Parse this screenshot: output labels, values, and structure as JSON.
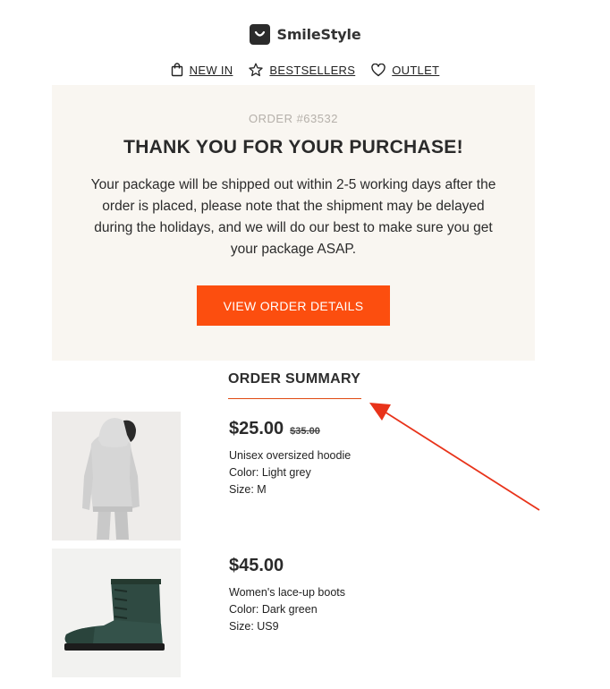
{
  "brand": {
    "name": "SmileStyle",
    "logo_icon": "smile-bag-icon"
  },
  "nav": [
    {
      "label": "NEW IN",
      "icon": "shopping-bag-icon"
    },
    {
      "label": "BESTSELLERS",
      "icon": "star-icon"
    },
    {
      "label": "OUTLET",
      "icon": "heart-icon"
    }
  ],
  "hero": {
    "order_number": "ORDER #63532",
    "title": "THANK YOU FOR YOUR PURCHASE!",
    "body": "Your package will be shipped out within 2-5 working days after the order is placed, please note that the shipment may be delayed during the holidays, and we will do our best to make sure you get your package ASAP.",
    "cta_label": "VIEW ORDER DETAILS",
    "background": "#f9f6f1",
    "accent": "#fc4e0f"
  },
  "summary": {
    "title": "ORDER SUMMARY"
  },
  "products": [
    {
      "price": "$25.00",
      "old_price": "$35.00",
      "name": "Unisex oversized hoodie",
      "color": "Color: Light grey",
      "size": "Size: M",
      "image": "grey-hoodie-photo"
    },
    {
      "price": "$45.00",
      "old_price": "",
      "name": "Women's lace-up boots",
      "color": "Color: Dark green",
      "size": "Size: US9",
      "image": "green-boot-photo"
    }
  ],
  "annotation": {
    "arrow_color": "#e8331a"
  }
}
